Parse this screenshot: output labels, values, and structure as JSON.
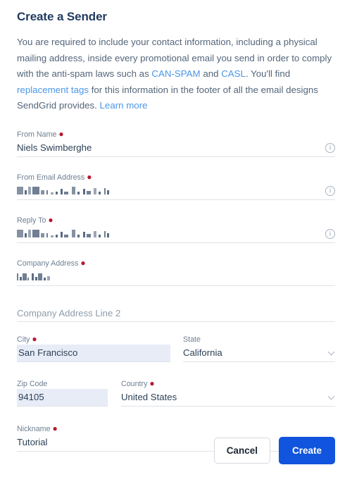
{
  "header": {
    "title": "Create a Sender",
    "intro": {
      "part1": "You are required to include your contact information, including a physical mailing address, inside every promotional email you send in order to comply with the anti-spam laws such as ",
      "link_canspam": "CAN-SPAM",
      "part2": " and ",
      "link_casl": "CASL",
      "part3": ". You'll find ",
      "link_replacement_tags": "replacement tags",
      "part4": " for this information in the footer of all the email designs SendGrid provides. ",
      "link_learn_more": "Learn more"
    }
  },
  "form": {
    "from_name": {
      "label": "From Name",
      "required": true,
      "value": "Niels Swimberghe",
      "info_icon": "info-circle-icon"
    },
    "from_email": {
      "label": "From Email Address",
      "required": true,
      "value": "",
      "redacted": true,
      "info_icon": "info-circle-icon"
    },
    "reply_to": {
      "label": "Reply To",
      "required": true,
      "value": "",
      "redacted": true,
      "info_icon": "info-circle-icon"
    },
    "company_address": {
      "label": "Company Address",
      "required": true,
      "value": "",
      "redacted": true
    },
    "company_address_2": {
      "label": "",
      "required": false,
      "placeholder": "Company Address Line 2",
      "value": ""
    },
    "city": {
      "label": "City",
      "required": true,
      "value": "San Francisco",
      "autofilled": true
    },
    "state": {
      "label": "State",
      "required": false,
      "value": "California",
      "control": "select",
      "chevron_icon": "chevron-down-icon"
    },
    "zip_code": {
      "label": "Zip Code",
      "required": false,
      "value": "94105",
      "autofilled": true
    },
    "country": {
      "label": "Country",
      "required": true,
      "value": "United States",
      "control": "select",
      "chevron_icon": "chevron-down-icon"
    },
    "nickname": {
      "label": "Nickname",
      "required": true,
      "value": "Tutorial",
      "info_icon": "info-circle-icon"
    }
  },
  "actions": {
    "cancel_label": "Cancel",
    "create_label": "Create"
  },
  "colors": {
    "primary_button": "#1154de",
    "link": "#4a97e8",
    "title": "#1f3a5f",
    "body_text": "#54667a",
    "required_marker": "#b5192c",
    "autofill_background": "#e7ecf7",
    "field_underline": "#dfe3e8"
  },
  "info_icon_glyph": "i"
}
